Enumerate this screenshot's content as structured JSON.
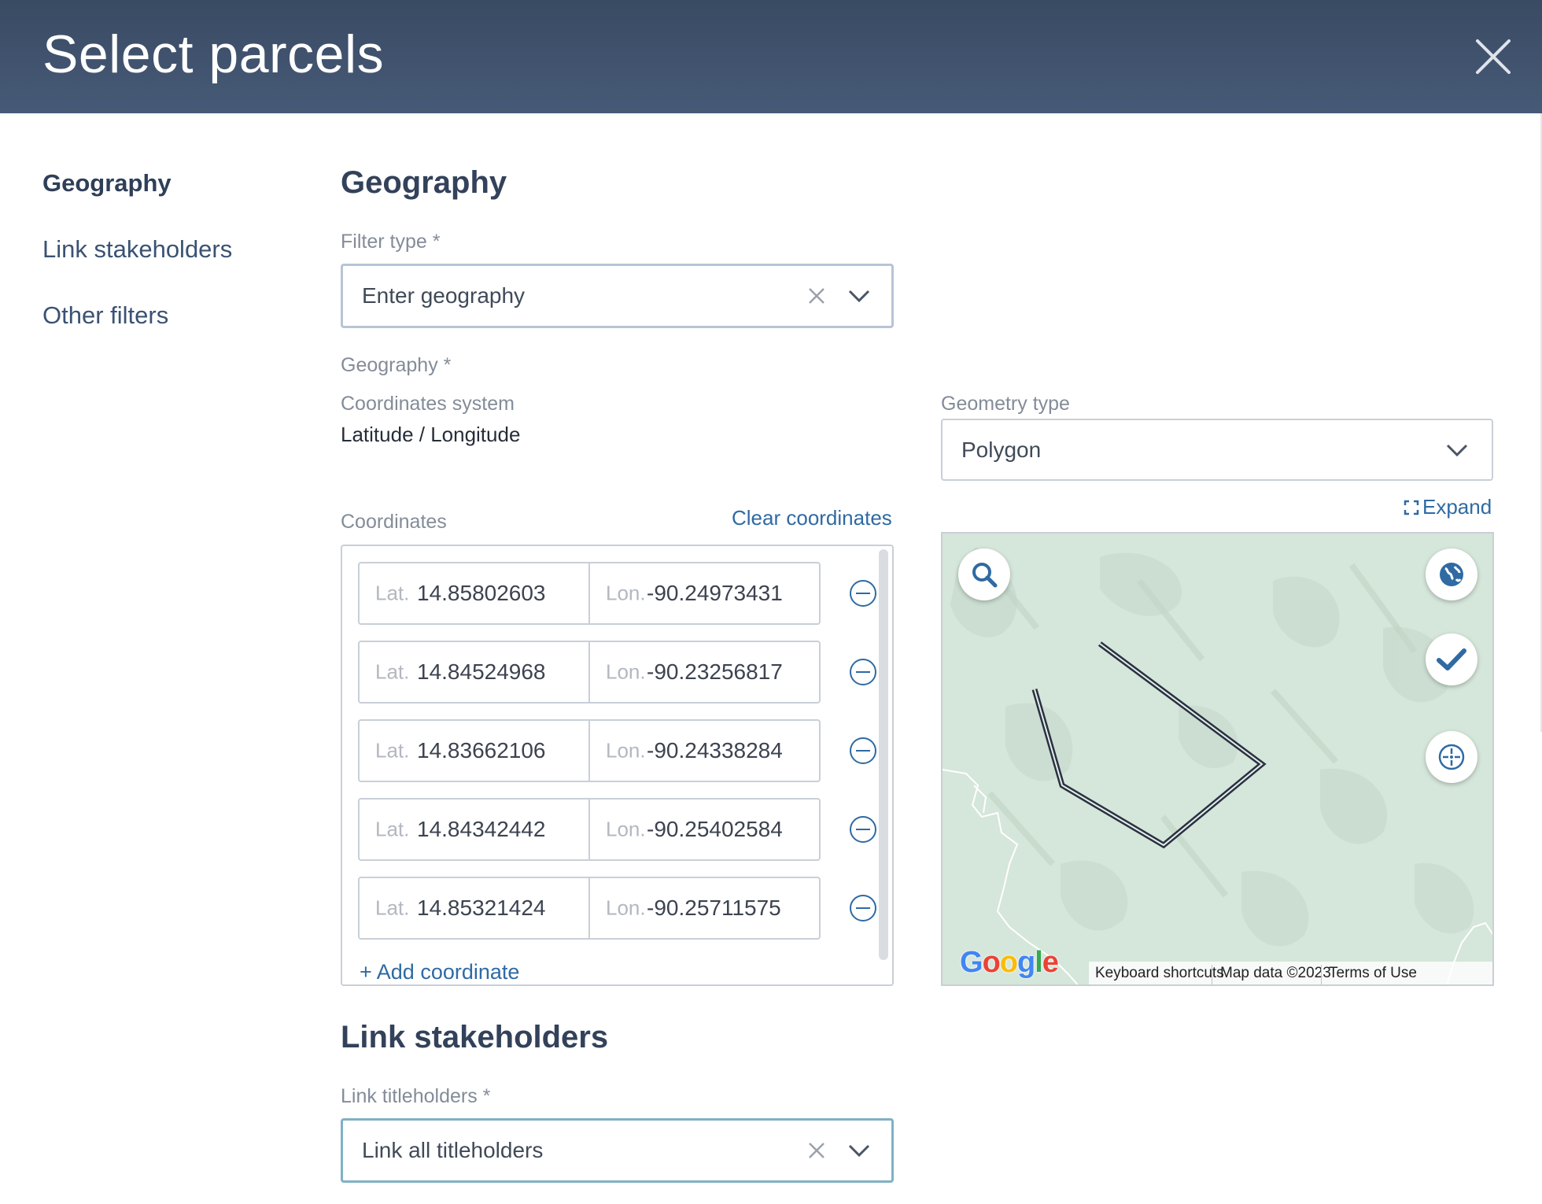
{
  "header": {
    "title": "Select parcels",
    "close_icon": "close-icon"
  },
  "nav": {
    "items": [
      {
        "label": "Geography",
        "active": true
      },
      {
        "label": "Link stakeholders",
        "active": false
      },
      {
        "label": "Other filters",
        "active": false
      }
    ]
  },
  "geography": {
    "section_title": "Geography",
    "filter_type": {
      "label": "Filter type *",
      "value": "Enter geography"
    },
    "geography_label": "Geography *",
    "coordinates_system": {
      "label": "Coordinates system",
      "value": "Latitude / Longitude"
    },
    "geometry_type": {
      "label": "Geometry type",
      "value": "Polygon"
    },
    "expand_label": "Expand",
    "coordinates": {
      "label": "Coordinates",
      "clear_label": "Clear coordinates",
      "lat_prefix": "Lat.",
      "lon_prefix": "Lon.",
      "rows": [
        {
          "lat": "14.85802603",
          "lon": "-90.24973431"
        },
        {
          "lat": "14.84524968",
          "lon": "-90.23256817"
        },
        {
          "lat": "14.83662106",
          "lon": "-90.24338284"
        },
        {
          "lat": "14.84342442",
          "lon": "-90.25402584"
        },
        {
          "lat": "14.85321424",
          "lon": "-90.25711575"
        }
      ],
      "add_label": "+ Add coordinate"
    },
    "map": {
      "keyboard_shortcuts": "Keyboard shortcuts",
      "map_data": "Map data ©2023",
      "terms": "Terms of Use",
      "logo_text": "Google",
      "buttons": [
        "search-icon",
        "globe-icon",
        "check-icon",
        "crosshair-icon"
      ]
    }
  },
  "link_stakeholders": {
    "section_title": "Link stakeholders",
    "titleholders": {
      "label": "Link titleholders *",
      "value": "Link all titleholders"
    }
  },
  "colors": {
    "header_bg": "#3a4a63",
    "link": "#2f6aa3",
    "map_bg": "#d6e6dc",
    "polygon": "#2a3142"
  }
}
